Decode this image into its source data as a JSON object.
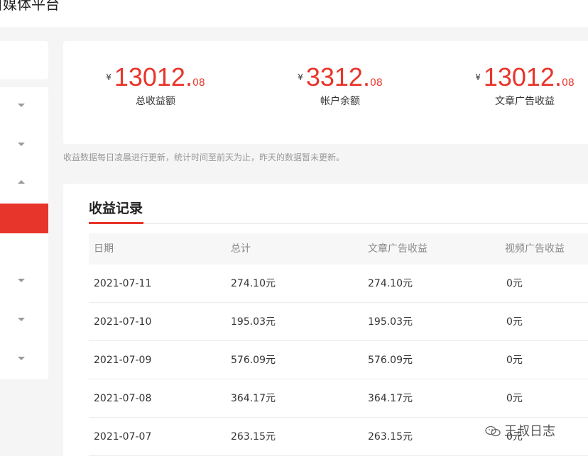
{
  "header": {
    "app_title": "自媒体平台"
  },
  "sidebar": {
    "items": [
      {
        "icon": "chevron-down-icon"
      },
      {
        "icon": "chevron-down-icon"
      },
      {
        "icon": "chevron-up-icon"
      },
      {
        "active": true
      },
      {
        "icon": "chevron-down-icon"
      },
      {
        "icon": "chevron-down-icon"
      },
      {
        "icon": "chevron-down-icon"
      }
    ],
    "active_color": "#e8352b"
  },
  "stats": [
    {
      "currency": "¥",
      "integer": "13012",
      "dot": ".",
      "decimal": "08",
      "label": "总收益额"
    },
    {
      "currency": "¥",
      "integer": "3312",
      "dot": ".",
      "decimal": "08",
      "label": "帐户余额"
    },
    {
      "currency": "¥",
      "integer": "13012",
      "dot": ".",
      "decimal": "08",
      "label": "文章广告收益"
    }
  ],
  "notice": "收益数据每日凌晨进行更新，统计时间至前天为止，昨天的数据暂未更新。",
  "records": {
    "title": "收益记录",
    "columns": [
      "日期",
      "总计",
      "文章广告收益",
      "视频广告收益"
    ],
    "rows": [
      [
        "2021-07-11",
        "274.10元",
        "274.10元",
        "0元"
      ],
      [
        "2021-07-10",
        "195.03元",
        "195.03元",
        "0元"
      ],
      [
        "2021-07-09",
        "576.09元",
        "576.09元",
        "0元"
      ],
      [
        "2021-07-08",
        "364.17元",
        "364.17元",
        "0元"
      ],
      [
        "2021-07-07",
        "263.15元",
        "263.15元",
        "0元"
      ]
    ]
  },
  "watermark": {
    "text": "王叔日志",
    "icon": "wechat-icon"
  },
  "colors": {
    "accent": "#e8352b",
    "page_bg": "#f5f5f5"
  }
}
